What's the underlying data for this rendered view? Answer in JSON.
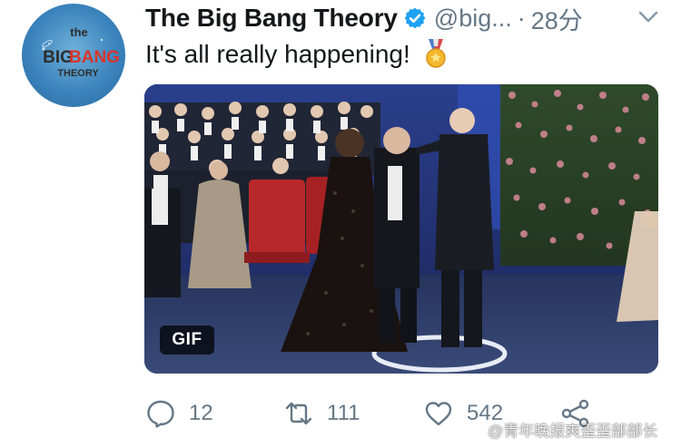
{
  "account": {
    "display_name": "The Big Bang Theory",
    "handle": "@big...",
    "separator": "·",
    "time_ago": "28分",
    "avatar_logo": {
      "line1": "the",
      "line2a": "BIG",
      "line2b": "BANG",
      "line3": "THEORY"
    }
  },
  "tweet": {
    "text": "It's all really happening!",
    "emoji": "medal-icon"
  },
  "media": {
    "badge": "GIF"
  },
  "actions": {
    "reply_count": "12",
    "retweet_count": "111",
    "like_count": "542"
  },
  "watermark": {
    "text": "@青年晚报爽歪歪部部长"
  },
  "colors": {
    "verified": "#1da1f2",
    "meta_gray": "#657786",
    "text": "#14171a",
    "logo_red": "#d9342b"
  }
}
